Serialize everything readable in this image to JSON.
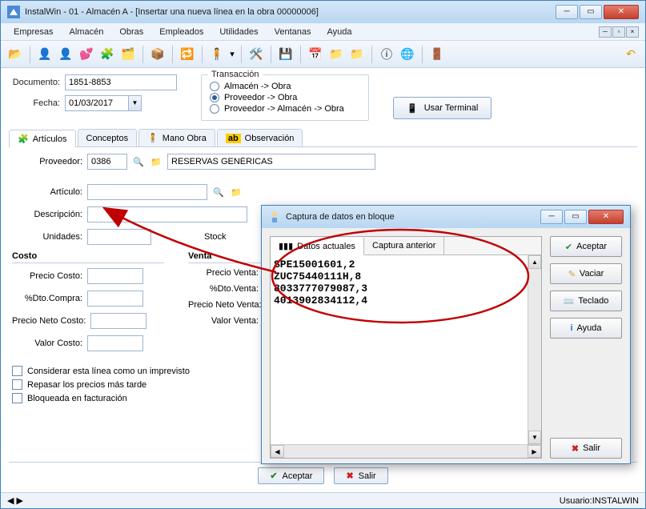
{
  "window": {
    "title": "InstalWin - 01 - Almacén A - [Insertar una nueva línea en la obra 00000006]"
  },
  "menu": {
    "items": [
      "Empresas",
      "Almacén",
      "Obras",
      "Empleados",
      "Utilidades",
      "Ventanas",
      "Ayuda"
    ]
  },
  "form": {
    "documento_label": "Documento:",
    "documento_value": "1851-8853",
    "fecha_label": "Fecha:",
    "fecha_value": "01/03/2017",
    "transaccion_legend": "Transacción",
    "trans_opts": [
      "Almacén -> Obra",
      "Proveedor -> Obra",
      "Proveedor -> Almacén -> Obra"
    ],
    "trans_selected": 1,
    "usar_terminal": "Usar Terminal"
  },
  "tabs": {
    "items": [
      "Artículos",
      "Conceptos",
      "Mano Obra",
      "Observación"
    ],
    "active": 0
  },
  "articulos": {
    "proveedor_label": "Proveedor:",
    "proveedor_code": "0386",
    "proveedor_name": "RESERVAS GENÉRICAS",
    "articulo_label": "Artículo:",
    "descripcion_label": "Descripción:",
    "unidades_label": "Unidades:",
    "stock_label": "Stock",
    "costo_header": "Costo",
    "venta_header": "Venta",
    "precio_costo": "Precio Costo:",
    "dto_compra": "%Dto.Compra:",
    "precio_neto_costo": "Precio Neto Costo:",
    "valor_costo": "Valor Costo:",
    "precio_venta": "Precio Venta:",
    "dto_venta": "%Dto.Venta:",
    "precio_neto_venta": "Precio Neto Venta:",
    "valor_venta": "Valor Venta:",
    "chk1": "Considerar esta línea como un imprevisto",
    "chk2": "Repasar los precios más tarde",
    "chk3": "Bloqueada en facturación"
  },
  "footer": {
    "aceptar": "Aceptar",
    "salir": "Salir"
  },
  "statusbar": {
    "user": "Usuario:INSTALWIN"
  },
  "dialog": {
    "title": "Captura de datos en bloque",
    "tab_actual": "Datos actuales",
    "tab_anterior": "Captura anterior",
    "text_content": "SPE15001601,2\nZUC75440111H,8\n8033777079087,3\n4013902834112,4",
    "btn_aceptar": "Aceptar",
    "btn_vaciar": "Vaciar",
    "btn_teclado": "Teclado",
    "btn_ayuda": "Ayuda",
    "btn_salir": "Salir"
  }
}
